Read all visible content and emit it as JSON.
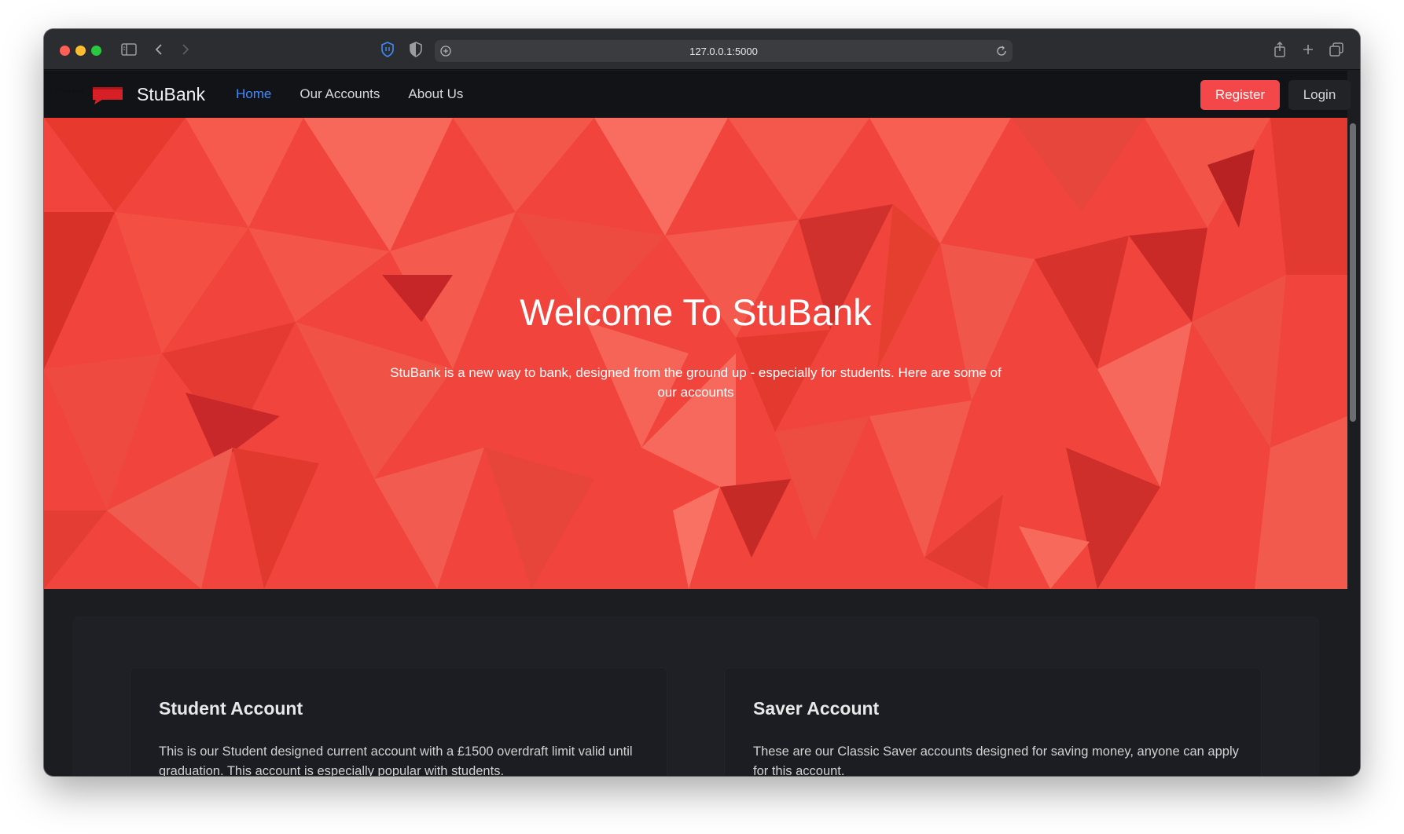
{
  "browser": {
    "url": "127.0.0.1:5000",
    "icons": [
      "sidebar-icon",
      "back-icon",
      "forward-icon",
      "shield-icon",
      "privacy-icon",
      "site-icon",
      "reload-icon",
      "share-icon",
      "new-tab-icon",
      "tabs-overview-icon"
    ]
  },
  "navbar": {
    "logo_text": "STUBANK",
    "brand": "StuBank",
    "links": [
      {
        "label": "Home",
        "active": true
      },
      {
        "label": "Our Accounts",
        "active": false
      },
      {
        "label": "About Us",
        "active": false
      }
    ],
    "register_label": "Register",
    "login_label": "Login"
  },
  "hero": {
    "title": "Welcome To StuBank",
    "subtitle": "StuBank is a new way to bank, designed from the ground up - especially for students. Here are some of our accounts"
  },
  "cards": [
    {
      "title": "Student Account",
      "text": "This is our Student designed current account with a £1500 overdraft limit valid until graduation. This account is especially popular with students."
    },
    {
      "title": "Saver Account",
      "text": "These are our Classic Saver accounts designed for saving money, anyone can apply for this account."
    }
  ],
  "colors": {
    "accent_red": "#f4474a",
    "hero_red": "#f0443c",
    "active_link": "#3d8bfd",
    "navbar_bg": "#121316",
    "page_bg": "#1b1d21"
  }
}
